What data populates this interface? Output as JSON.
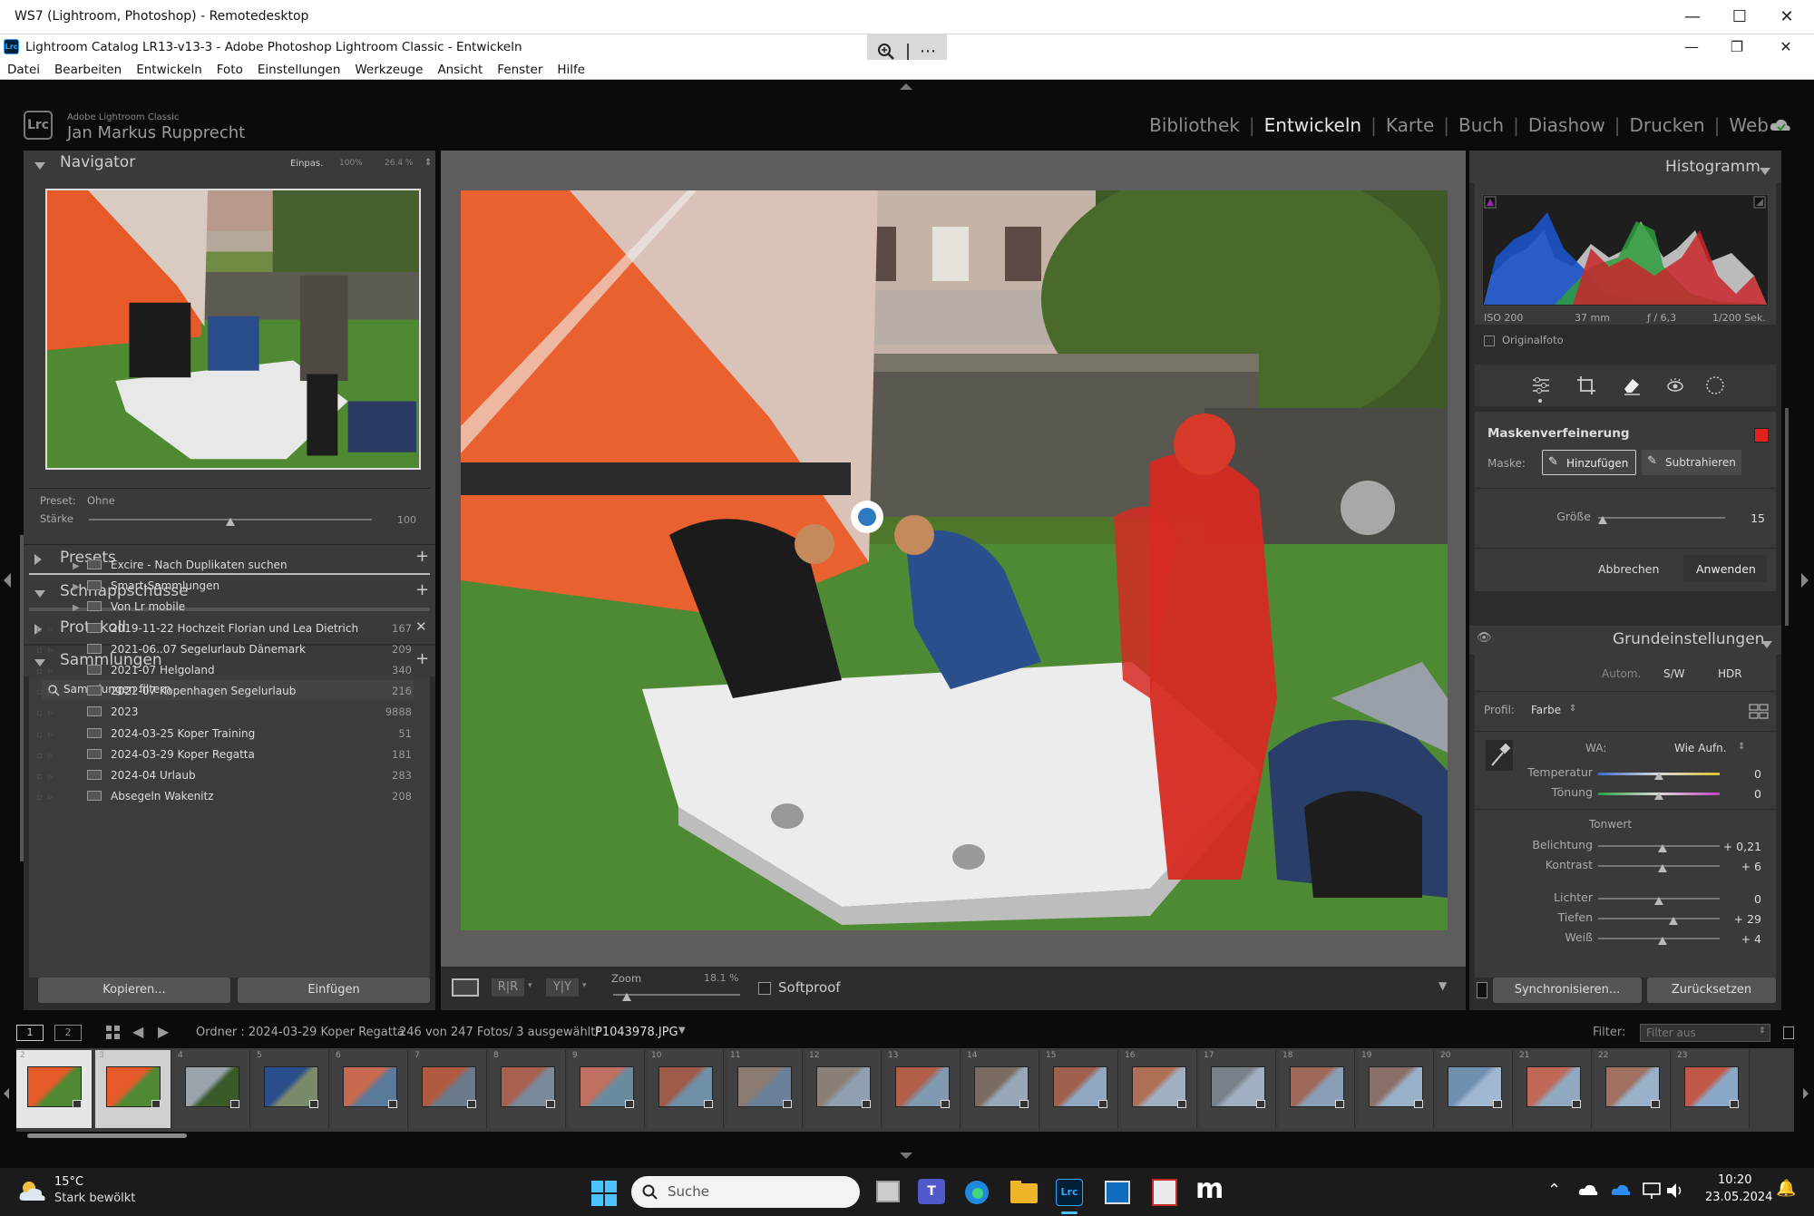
{
  "remote_window": {
    "title": "WS7 (Lightroom, Photoshop) - Remotedesktop"
  },
  "lr_window": {
    "title": "Lightroom Catalog LR13-v13-3 - Adobe Photoshop Lightroom Classic - Entwickeln",
    "app_icon": "Lrc"
  },
  "menu": [
    "Datei",
    "Bearbeiten",
    "Entwickeln",
    "Foto",
    "Einstellungen",
    "Werkzeuge",
    "Ansicht",
    "Fenster",
    "Hilfe"
  ],
  "identity": {
    "logo": "Lrc",
    "product": "Adobe Lightroom Classic",
    "user": "Jan Markus Rupprecht"
  },
  "modules": [
    {
      "label": "Bibliothek",
      "active": false
    },
    {
      "label": "Entwickeln",
      "active": true
    },
    {
      "label": "Karte",
      "active": false
    },
    {
      "label": "Buch",
      "active": false
    },
    {
      "label": "Diashow",
      "active": false
    },
    {
      "label": "Drucken",
      "active": false
    },
    {
      "label": "Web",
      "active": false
    }
  ],
  "navigator": {
    "title": "Navigator",
    "zoom_fit": "Einpas.",
    "zoom_100": "100%",
    "zoom_custom": "26.4 %"
  },
  "preset_amount": {
    "preset_label": "Preset:",
    "preset_value": "Ohne",
    "strength_label": "Stärke",
    "strength_value": "100",
    "strength_level": 0.5
  },
  "left_sections": {
    "presets": "Presets",
    "snapshots": "Schnappschüsse",
    "history": "Protokoll",
    "collections": "Sammlungen"
  },
  "collections_filter": "Sammlungen filtern",
  "collection_sets": [
    {
      "name": "Excire - Nach Duplikaten suchen"
    },
    {
      "name": "Smart-Sammlungen"
    },
    {
      "name": "Von Lr mobile"
    }
  ],
  "collections": [
    {
      "name": "2019-11-22 Hochzeit Florian und Lea Dietrich",
      "count": "167"
    },
    {
      "name": "2021-06..07 Segelurlaub Dänemark",
      "count": "209"
    },
    {
      "name": "2021-07 Helgoland",
      "count": "340"
    },
    {
      "name": "2022-07 Kopenhagen Segelurlaub",
      "count": "216"
    },
    {
      "name": "2023",
      "count": "9888"
    },
    {
      "name": "2024-03-25 Koper Training",
      "count": "51"
    },
    {
      "name": "2024-03-29 Koper Regatta",
      "count": "181"
    },
    {
      "name": "2024-04 Urlaub",
      "count": "283"
    },
    {
      "name": "Absegeln Wakenitz",
      "count": "208"
    }
  ],
  "left_buttons": {
    "copy": "Kopieren...",
    "paste": "Einfügen"
  },
  "toolbar": {
    "zoom_label": "Zoom",
    "zoom_value": "18.1 %",
    "softproof": "Softproof"
  },
  "histogram": {
    "title": "Histogramm",
    "iso": "ISO 200",
    "focal": "37 mm",
    "aperture": "ƒ / 6,3",
    "shutter": "1/200 Sek.",
    "original": "Originalfoto"
  },
  "mask_refine": {
    "title": "Maskenverfeinerung",
    "mask_label": "Maske:",
    "add": "Hinzufügen",
    "subtract": "Subtrahieren",
    "size_label": "Größe",
    "size_value": "15",
    "cancel": "Abbrechen",
    "apply": "Anwenden",
    "color": "#e0241b"
  },
  "basic": {
    "title": "Grundeinstellungen",
    "auto": "Autom.",
    "bw": "S/W",
    "hdr": "HDR",
    "profile_label": "Profil:",
    "profile_value": "Farbe",
    "wb_label": "WA:",
    "wb_value": "Wie Aufn.",
    "temp_label": "Temperatur",
    "temp_value": "0",
    "tint_label": "Tönung",
    "tint_value": "0",
    "tone_label": "Tonwert",
    "exposure_label": "Belichtung",
    "exposure_value": "+ 0,21",
    "contrast_label": "Kontrast",
    "contrast_value": "+ 6",
    "highlights_label": "Lichter",
    "highlights_value": "0",
    "shadows_label": "Tiefen",
    "shadows_value": "+ 29",
    "whites_label": "Weiß",
    "whites_value": "+ 4"
  },
  "right_buttons": {
    "sync": "Synchronisieren...",
    "reset": "Zurücksetzen"
  },
  "filmstrip_bar": {
    "view1": "1",
    "view2": "2",
    "source": "Ordner : 2024-03-29 Koper Regatta",
    "count": "246 von 247 Fotos/ 3 ausgewählt/",
    "file": "P1043978.JPG",
    "filter_label": "Filter:",
    "filter_value": "Filter aus"
  },
  "film_numbers": [
    "2",
    "3",
    "4",
    "5",
    "6",
    "7",
    "8",
    "9",
    "10",
    "11",
    "12",
    "13",
    "14",
    "15",
    "16",
    "17",
    "18",
    "19",
    "20",
    "21",
    "22",
    "23"
  ],
  "taskbar": {
    "temp": "15°C",
    "weather": "Stark bewölkt",
    "search": "Suche",
    "time": "10:20",
    "date": "23.05.2024"
  }
}
